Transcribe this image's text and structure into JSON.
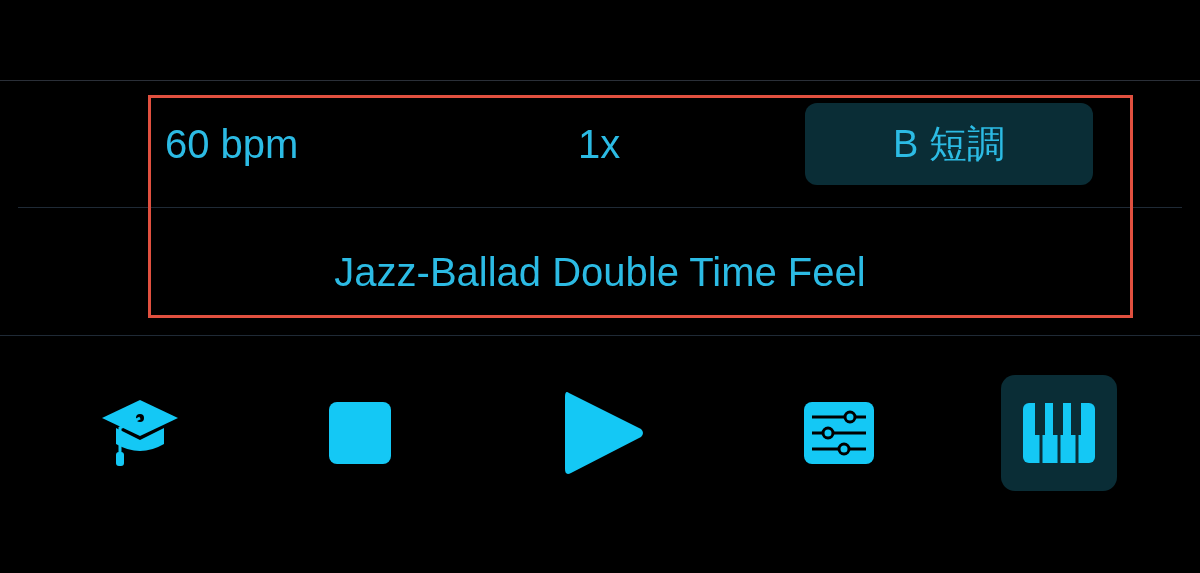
{
  "tempo": "60 bpm",
  "speed": "1x",
  "key": {
    "label": "B 短調"
  },
  "style_name": "Jazz-Ballad Double Time Feel",
  "toolbar": [
    {
      "kind": "lesson",
      "selected": false
    },
    {
      "kind": "stop",
      "selected": false
    },
    {
      "kind": "play",
      "selected": false
    },
    {
      "kind": "mixer",
      "selected": false
    },
    {
      "kind": "piano",
      "selected": true
    }
  ]
}
